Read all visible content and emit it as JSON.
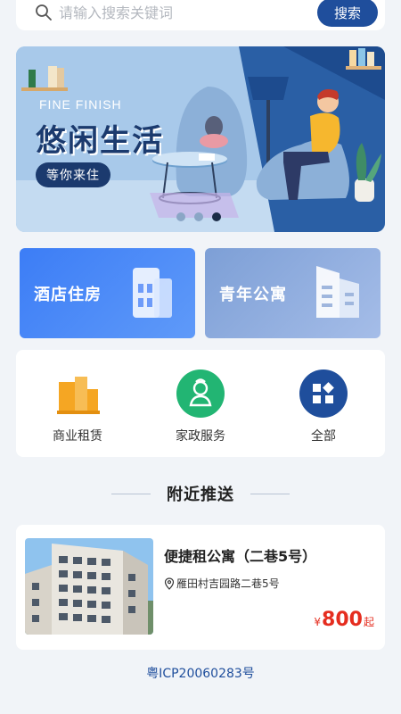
{
  "search": {
    "placeholder": "请输入搜索关键词",
    "value": "",
    "button_label": "搜索"
  },
  "banner": {
    "tag": "FINE FINISH",
    "title": "悠闲生活",
    "button_label": "等你来住",
    "dots": 3,
    "active_dot": 3
  },
  "categories": [
    {
      "label": "酒店住房",
      "icon": "hotel-building-icon"
    },
    {
      "label": "青年公寓",
      "icon": "apartment-building-icon"
    }
  ],
  "quick_actions": [
    {
      "label": "商业租赁",
      "icon": "commercial-building-icon",
      "color": "#f5a623"
    },
    {
      "label": "家政服务",
      "icon": "housekeeper-icon",
      "color": "#22b573"
    },
    {
      "label": "全部",
      "icon": "all-grid-icon",
      "color": "#1f4e9c"
    }
  ],
  "nearby": {
    "title": "附近推送",
    "listings": [
      {
        "title": "便捷租公寓（二巷5号）",
        "address": "雁田村吉园路二巷5号",
        "currency": "¥",
        "price": "800",
        "price_suffix": "起"
      }
    ]
  },
  "footer": {
    "icp": "粤ICP20060283号"
  },
  "colors": {
    "brand": "#1f4e9c",
    "price": "#e52d1f",
    "background": "#f1f4f8"
  }
}
